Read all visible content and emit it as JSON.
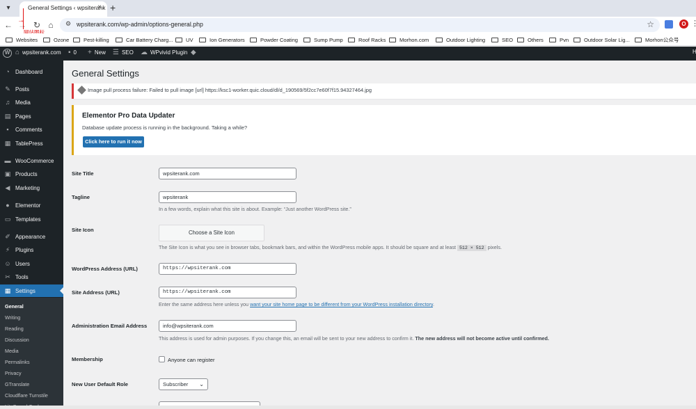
{
  "browser": {
    "tab_title": "General Settings ‹ wpsiterank",
    "url": "wpsiterank.com/wp-admin/options-general.php",
    "annotation_text": "网站图标",
    "bookmarks": [
      "Websites",
      "Ozone",
      "Pest-killing",
      "Car Battery Charg...",
      "UV",
      "Ion Generators",
      "Powder Coating",
      "Sump Pump",
      "Roof Racks",
      "Morhon.com",
      "Outdoor Lighting",
      "SEO",
      "Others",
      "Pvn",
      "Outdoor Solar Lig...",
      "Morhon公众号"
    ]
  },
  "adminbar": {
    "site_name": "wpsiterank.com",
    "comments_count": "0",
    "new_label": "New",
    "seo_label": "SEO",
    "wpvivid_label": "WPvivid Plugin",
    "right_edge": "H"
  },
  "sidebar": {
    "items": [
      {
        "label": "Dashboard",
        "icon": "dashboard-icon"
      },
      {
        "label": "Posts",
        "icon": "pin-icon"
      },
      {
        "label": "Media",
        "icon": "media-icon"
      },
      {
        "label": "Pages",
        "icon": "page-icon"
      },
      {
        "label": "Comments",
        "icon": "comment-icon"
      },
      {
        "label": "TablePress",
        "icon": "table-icon"
      },
      {
        "label": "WooCommerce",
        "icon": "woo-icon"
      },
      {
        "label": "Products",
        "icon": "product-icon"
      },
      {
        "label": "Marketing",
        "icon": "megaphone-icon"
      },
      {
        "label": "Elementor",
        "icon": "elementor-icon"
      },
      {
        "label": "Templates",
        "icon": "folder-icon"
      },
      {
        "label": "Appearance",
        "icon": "brush-icon"
      },
      {
        "label": "Plugins",
        "icon": "plugin-icon"
      },
      {
        "label": "Users",
        "icon": "user-icon"
      },
      {
        "label": "Tools",
        "icon": "wrench-icon"
      },
      {
        "label": "Settings",
        "icon": "settings-icon"
      }
    ],
    "submenu": [
      "General",
      "Writing",
      "Reading",
      "Discussion",
      "Media",
      "Permalinks",
      "Privacy",
      "GTranslate",
      "Cloudflare Turnstile",
      "LiteSpeed Cache"
    ]
  },
  "main": {
    "title": "General Settings",
    "error_notice": "Image pull process failure: Failed to pull image [url] https://ksc1-worker.quic.cloud/dl/d_190569/5f2cc7e60f7f15.94327464.jpg",
    "warning_title": "Elementor Pro Data Updater",
    "warning_text": "Database update process is running in the background. Taking a while?",
    "warning_button": "Click here to run it now",
    "fields": {
      "site_title_label": "Site Title",
      "site_title_value": "wpsiterank.com",
      "tagline_label": "Tagline",
      "tagline_value": "wpsiterank",
      "tagline_desc": "In a few words, explain what this site is about. Example: “Just another WordPress site.”",
      "site_icon_label": "Site Icon",
      "site_icon_button": "Choose a Site Icon",
      "site_icon_desc": "The Site Icon is what you see in browser tabs, bookmark bars, and within the WordPress mobile apps. It should be square and at least",
      "site_icon_size": "512 × 512",
      "site_icon_desc_end": "pixels.",
      "wp_address_label": "WordPress Address (URL)",
      "wp_address_value": "https://wpsiterank.com",
      "site_address_label": "Site Address (URL)",
      "site_address_value": "https://wpsiterank.com",
      "site_address_desc": "Enter the same address here unless you",
      "site_address_link": "want your site home page to be different from your WordPress installation directory",
      "admin_email_label": "Administration Email Address",
      "admin_email_value": "info@wpsiterank.com",
      "admin_email_desc": "This address is used for admin purposes. If you change this, an email will be sent to your new address to confirm it.",
      "admin_email_desc_bold": "The new address will not become active until confirmed.",
      "membership_label": "Membership",
      "membership_checkbox": "Anyone can register",
      "default_role_label": "New User Default Role",
      "default_role_value": "Subscriber"
    }
  }
}
